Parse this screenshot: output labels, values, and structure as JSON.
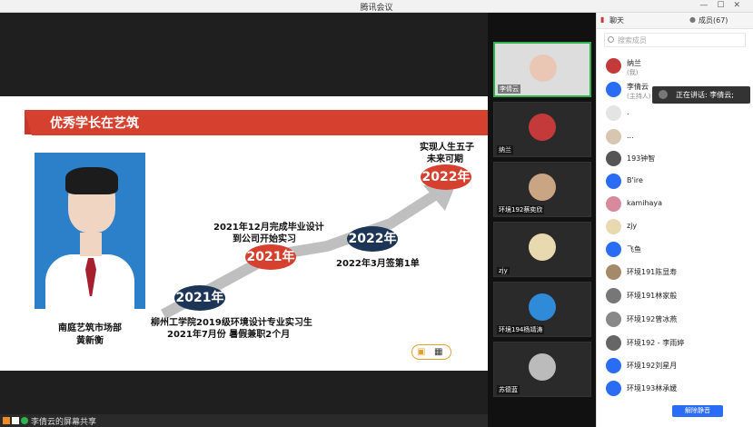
{
  "window": {
    "title": "腾讯会议"
  },
  "slide": {
    "header": "优秀学长在艺筑",
    "caption_line1": "南庭艺筑市场部",
    "caption_line2": "黄新衡",
    "milestones": [
      {
        "year": "2021年",
        "line1": "柳州工学院2019级环境设计专业实习生",
        "line2": "2021年7月份  暑假兼职2个月"
      },
      {
        "year": "2021年",
        "line1": "2021年12月完成毕业设计",
        "line2": "到公司开始实习"
      },
      {
        "year": "2022年",
        "line1": "2022年3月签第1单",
        "line2": ""
      },
      {
        "year": "2022年",
        "line1": "实现人生五子",
        "line2": "未来可期"
      }
    ]
  },
  "share_bar": {
    "label": "李倩云的屏幕共享"
  },
  "tiles": [
    {
      "name": "李倩云",
      "color": "#e9c7b4"
    },
    {
      "name": "纳兰",
      "color": "#c43a3a"
    },
    {
      "name": "环境192蔡奕欣",
      "color": "#caa583"
    },
    {
      "name": "zjy",
      "color": "#e8d9b0"
    },
    {
      "name": "环境194杨靖涛",
      "color": "#2f8ad8"
    },
    {
      "name": "苏德蓝",
      "color": "#bbbbbb"
    }
  ],
  "panel": {
    "tab_chat": "聊天",
    "tab_members": "成员(67)",
    "search_placeholder": "搜索成员",
    "unmute_all": "解除静音",
    "members": [
      {
        "name": "纳兰",
        "sub": "(我)",
        "color": "#c43a3a"
      },
      {
        "name": "李倩云",
        "sub": "(主持人)",
        "color": "#2a6df4"
      },
      {
        "name": ".",
        "sub": "",
        "color": "#e4e4e4"
      },
      {
        "name": "...",
        "sub": "",
        "color": "#d8c6b0"
      },
      {
        "name": "193钟智",
        "sub": "",
        "color": "#555"
      },
      {
        "name": "B'ire",
        "sub": "",
        "color": "#2a6df4"
      },
      {
        "name": "kamihaya",
        "sub": "",
        "color": "#d78a9b"
      },
      {
        "name": "zjy",
        "sub": "",
        "color": "#e8d9b0"
      },
      {
        "name": "飞鱼",
        "sub": "",
        "color": "#2a6df4"
      },
      {
        "name": "环境191陈显寿",
        "sub": "",
        "color": "#a58a6a"
      },
      {
        "name": "环境191林家般",
        "sub": "",
        "color": "#777"
      },
      {
        "name": "环境192曾冰燕",
        "sub": "",
        "color": "#888"
      },
      {
        "name": "环境192 - 李雨婷",
        "sub": "",
        "color": "#666"
      },
      {
        "name": "环境192刘星月",
        "sub": "",
        "color": "#2a6df4"
      },
      {
        "name": "环境193林承媛",
        "sub": "",
        "color": "#2a6df4"
      }
    ]
  },
  "speaking": {
    "text": "正在讲话: 李倩云;"
  },
  "colors": {
    "accent": "#d6402f",
    "navy": "#1d3557",
    "red_oval": "#d6402f",
    "blue": "#2a6df4"
  }
}
